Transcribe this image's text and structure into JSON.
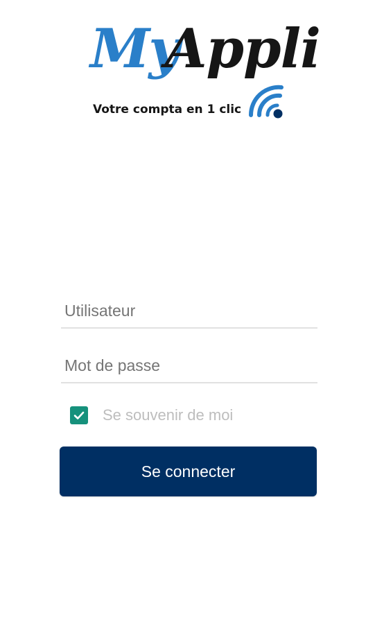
{
  "logo": {
    "title_part1": "My",
    "title_part2": "Appli",
    "tagline": "Votre compta en 1 clic",
    "icon": "wifi-signal-icon",
    "colors": {
      "my": "#2a7fc9",
      "appli": "#161616",
      "wifi_arcs": "#2a7fc9",
      "wifi_dot": "#002f63"
    }
  },
  "form": {
    "username": {
      "placeholder": "Utilisateur",
      "value": ""
    },
    "password": {
      "placeholder": "Mot de passe",
      "value": ""
    },
    "remember": {
      "label": "Se souvenir de moi",
      "checked": true,
      "icon": "checkmark-icon"
    },
    "submit_label": "Se connecter"
  },
  "colors": {
    "primary_button": "#002f63",
    "checkbox": "#16917c",
    "field_underline": "#e1e1e1",
    "placeholder": "#757575",
    "remember_label": "#bdbdbd",
    "background": "#ffffff"
  }
}
